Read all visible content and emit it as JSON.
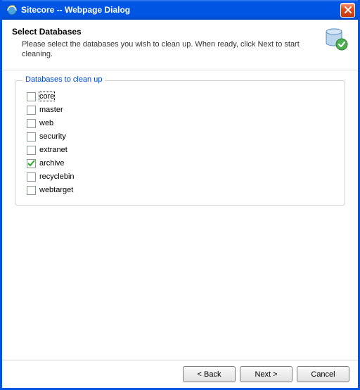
{
  "window": {
    "title": "Sitecore -- Webpage Dialog"
  },
  "header": {
    "title": "Select Databases",
    "description": "Please select the databases you wish to clean up. When ready, click Next to start cleaning."
  },
  "fieldset": {
    "legend": "Databases to clean up"
  },
  "databases": [
    {
      "label": "core",
      "checked": false,
      "focused": true
    },
    {
      "label": "master",
      "checked": false,
      "focused": false
    },
    {
      "label": "web",
      "checked": false,
      "focused": false
    },
    {
      "label": "security",
      "checked": false,
      "focused": false
    },
    {
      "label": "extranet",
      "checked": false,
      "focused": false
    },
    {
      "label": "archive",
      "checked": true,
      "focused": false
    },
    {
      "label": "recyclebin",
      "checked": false,
      "focused": false
    },
    {
      "label": "webtarget",
      "checked": false,
      "focused": false
    }
  ],
  "buttons": {
    "back": "< Back",
    "next": "Next >",
    "cancel": "Cancel"
  }
}
